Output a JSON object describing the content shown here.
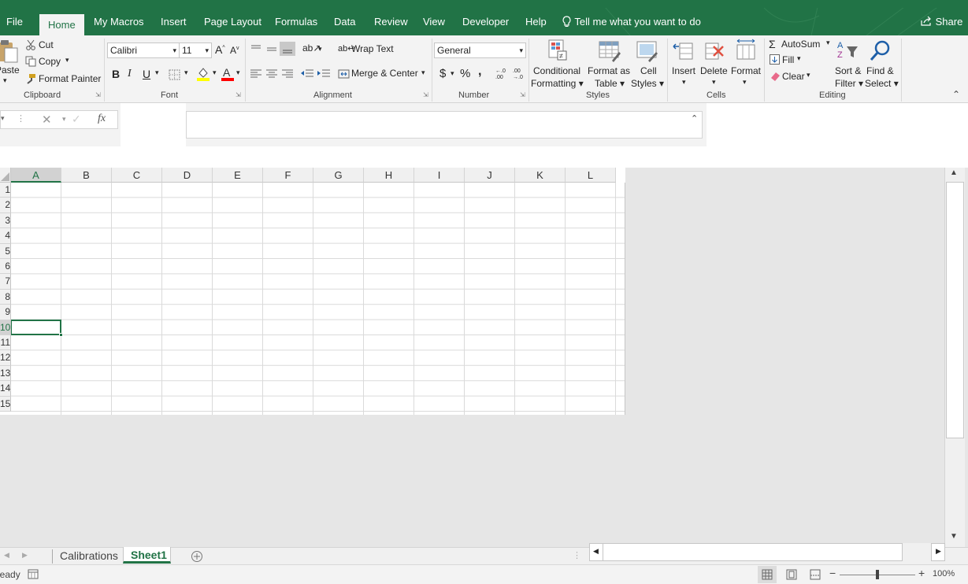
{
  "app": {
    "accent": "#217346"
  },
  "tabs": [
    "File",
    "Home",
    "My Macros",
    "Insert",
    "Page Layout",
    "Formulas",
    "Data",
    "Review",
    "View",
    "Developer",
    "Help"
  ],
  "tell_me": "Tell me what you want to do",
  "share": "Share",
  "clipboard": {
    "paste": "Paste",
    "cut": "Cut",
    "copy": "Copy",
    "format_painter": "Format Painter",
    "group": "Clipboard"
  },
  "font": {
    "name": "Calibri",
    "size": "11",
    "bold": "B",
    "italic": "I",
    "underline": "U",
    "group": "Font"
  },
  "alignment": {
    "wrap_text": "Wrap Text",
    "merge_center": "Merge & Center",
    "group": "Alignment"
  },
  "number": {
    "format": "General",
    "currency": "$",
    "percent": "%",
    "comma": ",",
    "increase_decimal": ".0→.00",
    "decrease_decimal": ".00→.0",
    "group": "Number"
  },
  "styles": {
    "conditional_1": "Conditional",
    "conditional_2": "Formatting",
    "format_table_1": "Format as",
    "format_table_2": "Table",
    "cell_styles_1": "Cell",
    "cell_styles_2": "Styles",
    "group": "Styles"
  },
  "cells": {
    "insert": "Insert",
    "delete": "Delete",
    "format": "Format",
    "group": "Cells"
  },
  "editing": {
    "autosum": "AutoSum",
    "fill": "Fill",
    "clear": "Clear",
    "sort_1": "Sort &",
    "sort_2": "Filter",
    "find_1": "Find &",
    "find_2": "Select",
    "group": "Editing"
  },
  "formula_bar": {
    "fx": "fx",
    "value": ""
  },
  "columns": [
    "A",
    "B",
    "C",
    "D",
    "E",
    "F",
    "G",
    "H",
    "I",
    "J",
    "K",
    "L"
  ],
  "rows": [
    "1",
    "2",
    "3",
    "4",
    "5",
    "6",
    "7",
    "8",
    "9",
    "10",
    "11",
    "12",
    "13",
    "14",
    "15"
  ],
  "active_cell": {
    "row": "10",
    "col": "A"
  },
  "sheet_tabs": [
    "Calibrations",
    "Sheet1"
  ],
  "active_sheet": "Sheet1",
  "status": {
    "ready": "Ready",
    "zoom": "100%"
  }
}
